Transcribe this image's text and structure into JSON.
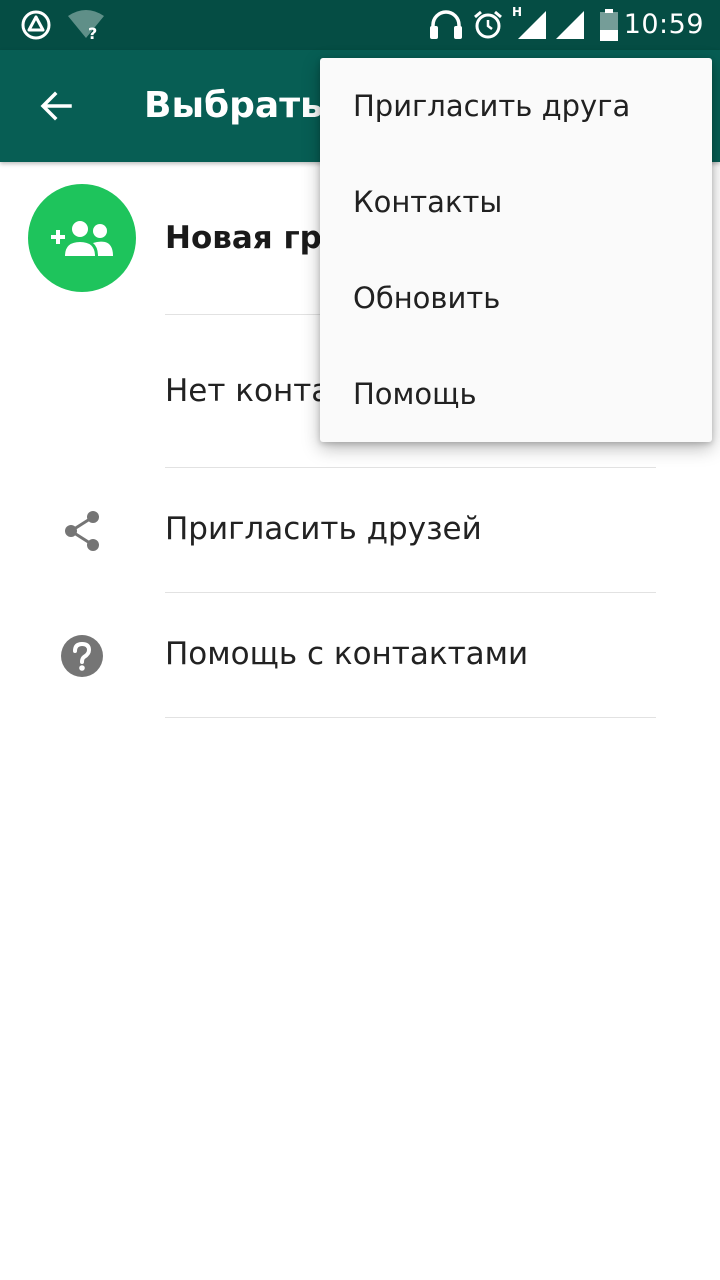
{
  "status_bar": {
    "time": "10:59",
    "network_type": "H",
    "icons": [
      "app-triangle-icon",
      "wifi-unknown-icon",
      "headset-icon",
      "alarm-icon",
      "signal-icon",
      "signal-icon",
      "battery-icon"
    ]
  },
  "app_bar": {
    "back_icon": "arrow-left-icon",
    "title": "Выбрать"
  },
  "list": {
    "new_group_label": "Новая гру",
    "no_contacts_label": "Нет конта",
    "invite_friends_label": "Пригласить друзей",
    "contacts_help_label": "Помощь с контактами"
  },
  "overflow_menu": {
    "items": [
      {
        "label": "Пригласить друга"
      },
      {
        "label": "Контакты"
      },
      {
        "label": "Обновить"
      },
      {
        "label": "Помощь"
      }
    ]
  },
  "colors": {
    "status_bar": "#054d44",
    "app_bar": "#075e54",
    "accent_green": "#1ec45c",
    "menu_background": "#fafafa"
  }
}
